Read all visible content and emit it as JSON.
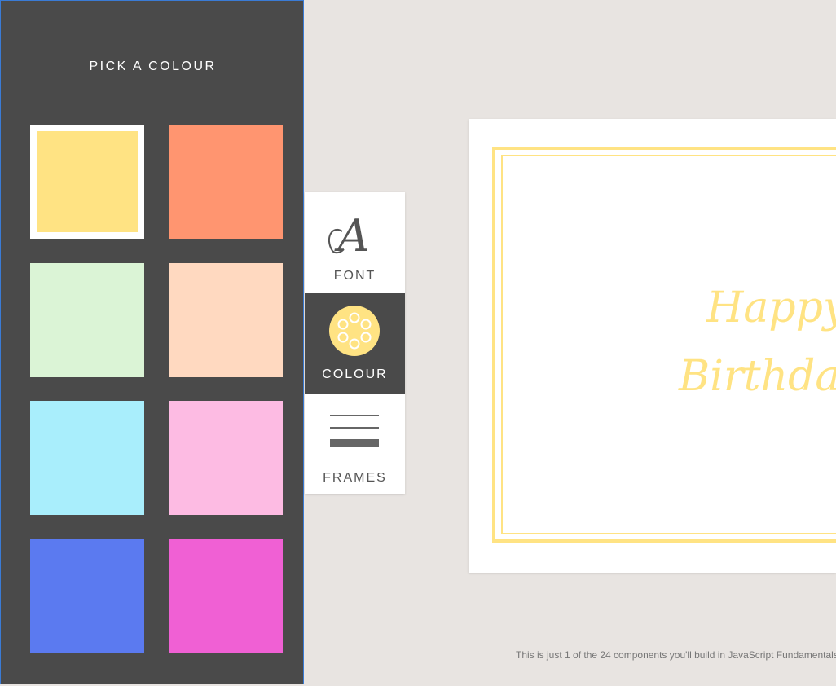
{
  "panel": {
    "title": "PICK A COLOUR",
    "swatches": [
      {
        "name": "yellow",
        "color": "#ffe383",
        "selected": true
      },
      {
        "name": "orange",
        "color": "#ff9570",
        "selected": false
      },
      {
        "name": "light-green",
        "color": "#dbf4d6",
        "selected": false
      },
      {
        "name": "peach",
        "color": "#ffd9c0",
        "selected": false
      },
      {
        "name": "light-blue",
        "color": "#a9eefc",
        "selected": false
      },
      {
        "name": "pink",
        "color": "#fdbbe3",
        "selected": false
      },
      {
        "name": "blue",
        "color": "#5b7af0",
        "selected": false
      },
      {
        "name": "magenta",
        "color": "#f060d4",
        "selected": false
      }
    ]
  },
  "toolbar": {
    "font_label": "FONT",
    "colour_label": "COLOUR",
    "frames_label": "FRAMES",
    "active": "colour"
  },
  "card": {
    "line1": "Happy",
    "line2": "Birthday",
    "accent_color": "#ffe383"
  },
  "footer": {
    "note": "This is just 1 of the 24 components you'll build in JavaScript Fundamentals"
  }
}
